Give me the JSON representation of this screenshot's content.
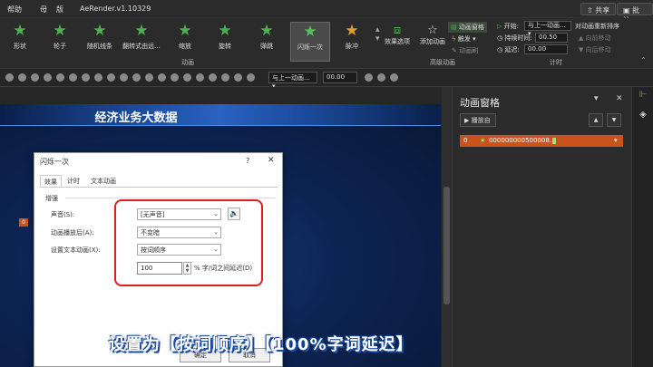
{
  "titlebar": {
    "menu": [
      "帮助",
      "母",
      "版"
    ],
    "title": "AeRender.v1.10329",
    "share": "共享",
    "comment": "批注"
  },
  "ribbon": {
    "effects": [
      {
        "label": "形状"
      },
      {
        "label": "轮子"
      },
      {
        "label": "随机线条"
      },
      {
        "label": "翻转式由远..."
      },
      {
        "label": "缩放"
      },
      {
        "label": "旋转"
      },
      {
        "label": "弹跳"
      },
      {
        "label": "闪烁一次"
      },
      {
        "label": "脉冲"
      }
    ],
    "group_animation": "动画",
    "effect_options": "效果选项",
    "add_animation": "添加动画",
    "animation_pane": "动画窗格",
    "trigger": "触发",
    "animation_painter": "动画刷",
    "group_advanced": "高级动画",
    "start_label": "开始:",
    "start_value": "与上一动画...",
    "duration_label": "持续时间:",
    "duration_value": "00.50",
    "delay_label": "延迟:",
    "delay_value": "00.00",
    "reorder": "对动画重新排序",
    "move_earlier": "向前移动",
    "move_later": "向后移动",
    "group_timing": "计时"
  },
  "toolbar2": {
    "start_value": "与上一动画...",
    "delay_value": "00.00"
  },
  "slide": {
    "title": "经济业务大数据",
    "badge": "0"
  },
  "dialog": {
    "title": "闪烁一次",
    "help": "?",
    "close": "✕",
    "tabs": [
      "效果",
      "计时",
      "文本动画"
    ],
    "section": "增强",
    "sound_label": "声音(S):",
    "sound_value": "[无声音]",
    "after_label": "动画播放后(A):",
    "after_value": "不变暗",
    "text_label": "设置文本动画(X):",
    "text_value": "按词顺序",
    "delay_value": "100",
    "delay_unit": "% 字/词之间延迟(D)",
    "ok": "确定",
    "cancel": "取消"
  },
  "pane": {
    "title": "动画窗格",
    "play": "播放自",
    "item_index": "0",
    "item_name": "000000000500008..."
  },
  "caption": "设置为【按词顺序】【100%字词延迟】",
  "colors": {
    "accent_green": "#4cb050",
    "highlight_orange": "#c8531c",
    "annotation_red": "#e01e1e"
  }
}
